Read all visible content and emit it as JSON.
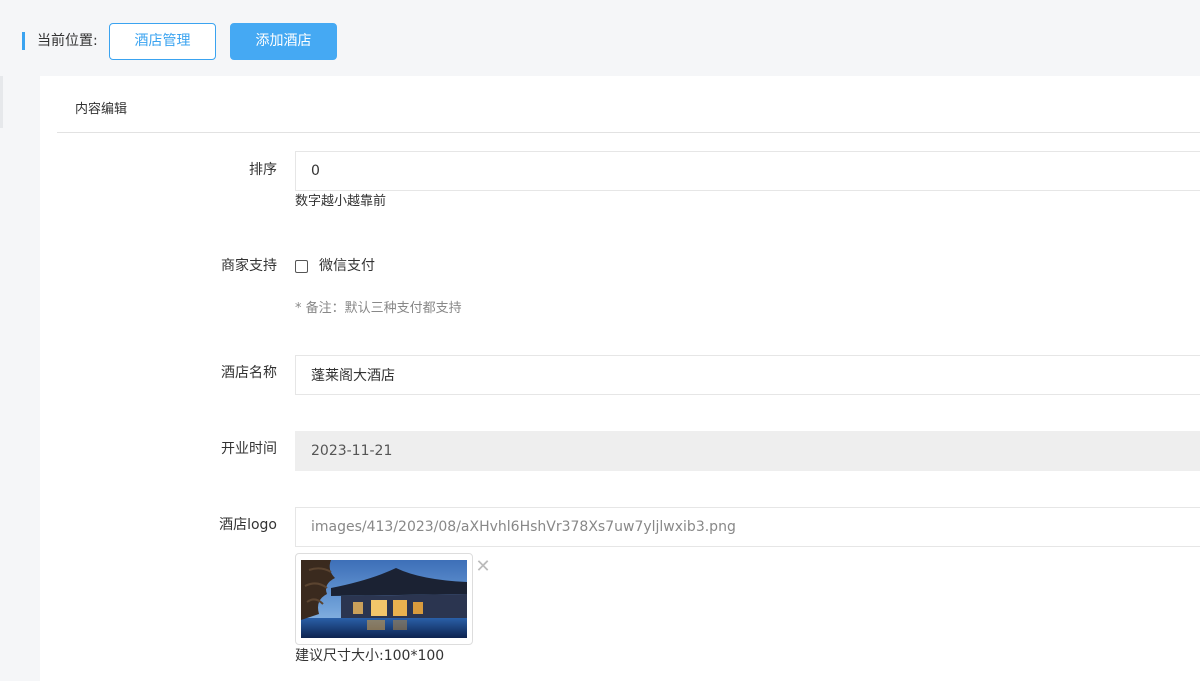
{
  "breadcrumb": {
    "label": "当前位置:",
    "items": [
      "酒店管理",
      "添加酒店"
    ]
  },
  "panel": {
    "title": "内容编辑"
  },
  "form": {
    "sort": {
      "label": "排序",
      "value": "0",
      "help": "数字越小越靠前"
    },
    "merchant_support": {
      "label": "商家支持",
      "option": "微信支付",
      "checked": false,
      "note": "* 备注：默认三种支付都支持"
    },
    "hotel_name": {
      "label": "酒店名称",
      "value": "蓬莱阁大酒店"
    },
    "open_date": {
      "label": "开业时间",
      "value": "2023-11-21"
    },
    "logo": {
      "label": "酒店logo",
      "value": "images/413/2023/08/aXHvhl6HshVr378Xs7uw7yljlwxib3.png",
      "help": "建议尺寸大小:100*100"
    }
  },
  "icons": {
    "remove": "close-icon"
  },
  "colors": {
    "accent": "#45a9f3",
    "accent_border": "#3aa3f0"
  }
}
